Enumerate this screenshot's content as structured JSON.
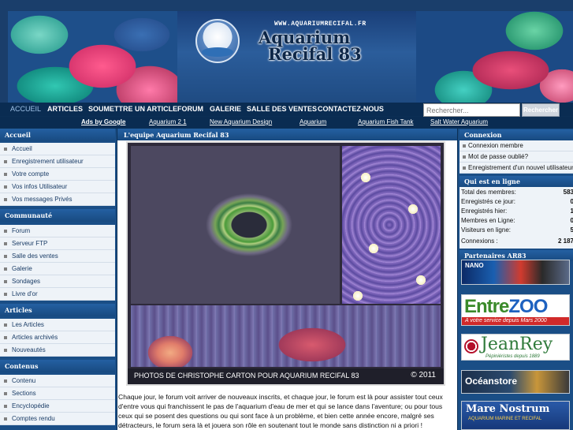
{
  "header": {
    "site_url": "WWW.AQUARIUMRECIFAL.FR",
    "site_name_line1": "Aquarium",
    "site_name_line2": "Recifal 83",
    "logo_badge": "AR83"
  },
  "nav": {
    "items": [
      {
        "label": "ACCUEIL",
        "active": true
      },
      {
        "label": "ARTICLES"
      },
      {
        "label": "SOUMETTRE UN ARTICLE"
      },
      {
        "label": "FORUM"
      },
      {
        "label": "GALERIE"
      },
      {
        "label": "SALLE DES VENTES"
      },
      {
        "label": "CONTACTEZ-NOUS"
      }
    ],
    "search_placeholder": "Rechercher...",
    "search_button": "Rechercher"
  },
  "ads": {
    "label": "Ads by Google",
    "links": [
      "Aquarium 2 1",
      "New Aquarium Design",
      "Aquarium",
      "Aquarium Fish Tank",
      "Salt Water Aquarium"
    ]
  },
  "left": {
    "sections": [
      {
        "title": "Accueil",
        "items": [
          "Accueil",
          "Enregistrement utilisateur",
          "Votre compte",
          "Vos infos Utilisateur",
          "Vos messages Privés"
        ]
      },
      {
        "title": "Communauté",
        "items": [
          "Forum",
          "Serveur FTP",
          "Salle des ventes",
          "Galerie",
          "Sondages",
          "Livre d'or"
        ]
      },
      {
        "title": "Articles",
        "items": [
          "Les Articles",
          "Articles archivés",
          "Nouveautés"
        ]
      },
      {
        "title": "Contenus",
        "items": [
          "Contenu",
          "Sections",
          "Encyclopédie",
          "Comptes rendu"
        ]
      }
    ]
  },
  "center": {
    "title": "L'equipe Aquarium Recifal 83",
    "photo_caption": "PHOTOS DE CHRISTOPHE CARTON  POUR AQUARIUM RECIFAL 83",
    "photo_year": "© 2011",
    "intro": "Chaque jour, le forum voit arriver de nouveaux inscrits, et chaque jour, le forum est là pour assister tout ceux d'entre vous qui franchissent le pas de l'aquarium d'eau de mer et qui se lance dans l'aventure; ou pour tous ceux qui se posent des questions ou qui sont face à un problème, et bien cette année encore, malgré ses détracteurs, le forum sera là et jouera son rôle en soutenant tout le monde sans distinction ni a priori !"
  },
  "right": {
    "connexion_title": "Connexion",
    "connexion_items": [
      "Connexion membre",
      "Mot de passe oublié?",
      "Enregistrement d'un nouvel utilisateur"
    ],
    "online_title": "Qui est en ligne",
    "stats": [
      {
        "label": "Total des membres:",
        "value": "583"
      },
      {
        "label": "Enregistrés ce jour:",
        "value": "0"
      },
      {
        "label": "Enregistrés hier:",
        "value": "1"
      },
      {
        "label": "Membres en Ligne:",
        "value": "0"
      },
      {
        "label": "Visiteurs en ligne:",
        "value": "5"
      },
      {
        "label": "Connexions :",
        "value": "2 187"
      }
    ],
    "partners_title": "Partenaires AR83",
    "partners": {
      "nano": "NANO",
      "entrezoo_a": "Entre",
      "entrezoo_b": "ZOO",
      "entrezoo_tag": "A votre service depuis Mars 2000",
      "jeanrey": "JeanRey",
      "jeanrey_tag": "Pépiniéristes depuis 1889",
      "oceanstore": "Océanstore",
      "mare": "Mare Nostrum",
      "mare_tag": "AQUARIUM MARINE ET RECIFAL"
    }
  }
}
